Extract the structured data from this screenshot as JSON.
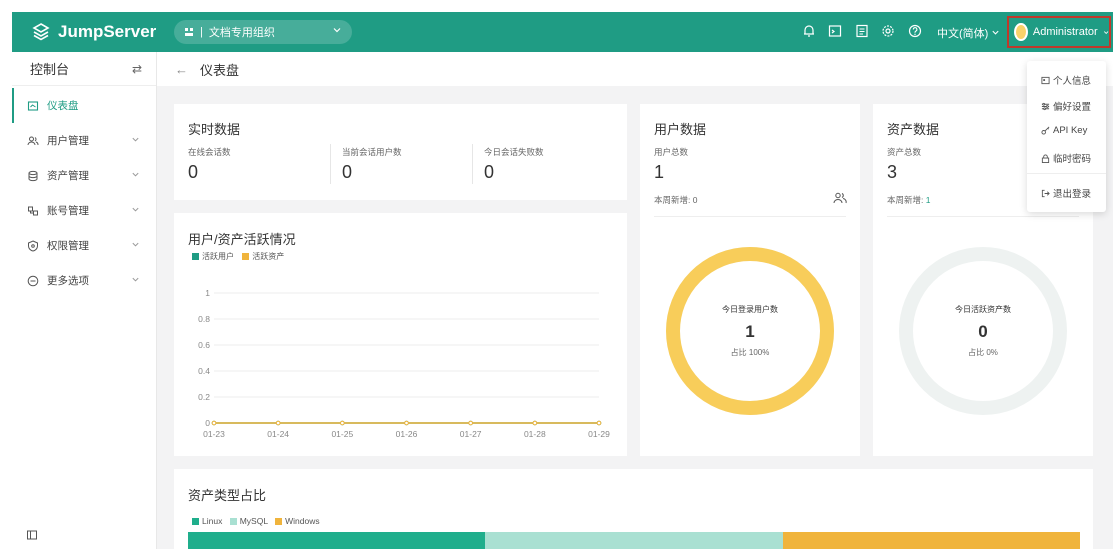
{
  "header": {
    "logo_text": "JumpServer",
    "org_label": "文档专用组织",
    "language": "中文(简体)",
    "user": "Administrator",
    "icons": [
      "bell-icon",
      "terminal-icon",
      "list-icon",
      "settings-icon",
      "help-icon"
    ]
  },
  "sidebar": {
    "title": "控制台",
    "items": [
      {
        "label": "仪表盘",
        "active": true,
        "icon": "dashboard-icon"
      },
      {
        "label": "用户管理",
        "icon": "users-icon"
      },
      {
        "label": "资产管理",
        "icon": "asset-icon"
      },
      {
        "label": "账号管理",
        "icon": "account-icon"
      },
      {
        "label": "权限管理",
        "icon": "shield-icon"
      },
      {
        "label": "更多选项",
        "icon": "more-icon"
      }
    ]
  },
  "breadcrumb": {
    "title": "仪表盘"
  },
  "realtime": {
    "title": "实时数据",
    "stats": [
      {
        "label": "在线会话数",
        "value": "0"
      },
      {
        "label": "当前会话用户数",
        "value": "0"
      },
      {
        "label": "今日会话失败数",
        "value": "0"
      }
    ]
  },
  "user_data": {
    "title": "用户数据",
    "total_label": "用户总数",
    "total": "1",
    "weekly_label": "本周新增:",
    "weekly": "0",
    "donut_label": "今日登录用户数",
    "donut_value": "1",
    "donut_pct": "占比 100%",
    "ratio": 1.0
  },
  "asset_data": {
    "title": "资产数据",
    "total_label": "资产总数",
    "total": "3",
    "weekly_label": "本周新增:",
    "weekly": "1",
    "donut_label": "今日活跃资产数",
    "donut_value": "0",
    "donut_pct": "占比 0%",
    "ratio": 0.0
  },
  "activity": {
    "title": "用户/资产活跃情况"
  },
  "chart_data": {
    "type": "line",
    "title": "用户/资产活跃情况",
    "x": [
      "01-23",
      "01-24",
      "01-25",
      "01-26",
      "01-27",
      "01-28",
      "01-29"
    ],
    "yticks": [
      "0",
      "0.2",
      "0.4",
      "0.6",
      "0.8",
      "1"
    ],
    "ylim": [
      0,
      1
    ],
    "series": [
      {
        "name": "活跃用户",
        "values": [
          0,
          0,
          0,
          0,
          0,
          0,
          0
        ],
        "color": "#1f9c84"
      },
      {
        "name": "活跃资产",
        "values": [
          0,
          0,
          0,
          0,
          0,
          0,
          0
        ],
        "color": "#f0b43c"
      }
    ],
    "legend": "top-left",
    "grid": true
  },
  "asset_types": {
    "title": "资产类型占比",
    "legend": [
      {
        "name": "Linux",
        "color": "#1fae8c",
        "value": 1
      },
      {
        "name": "MySQL",
        "color": "#a9e0d2",
        "value": 1
      },
      {
        "name": "Windows",
        "color": "#f0b43c",
        "value": 1
      }
    ]
  },
  "user_menu": {
    "items": [
      {
        "label": "个人信息",
        "icon": "profile-icon"
      },
      {
        "label": "偏好设置",
        "icon": "preferences-icon"
      },
      {
        "label": "API Key",
        "icon": "key-icon"
      },
      {
        "label": "临时密码",
        "icon": "lock-icon"
      },
      {
        "label": "退出登录",
        "icon": "logout-icon"
      }
    ]
  },
  "colors": {
    "brand": "#1f9c84",
    "donut_user": "#f8cd5a",
    "donut_asset": "#eef2f1"
  }
}
